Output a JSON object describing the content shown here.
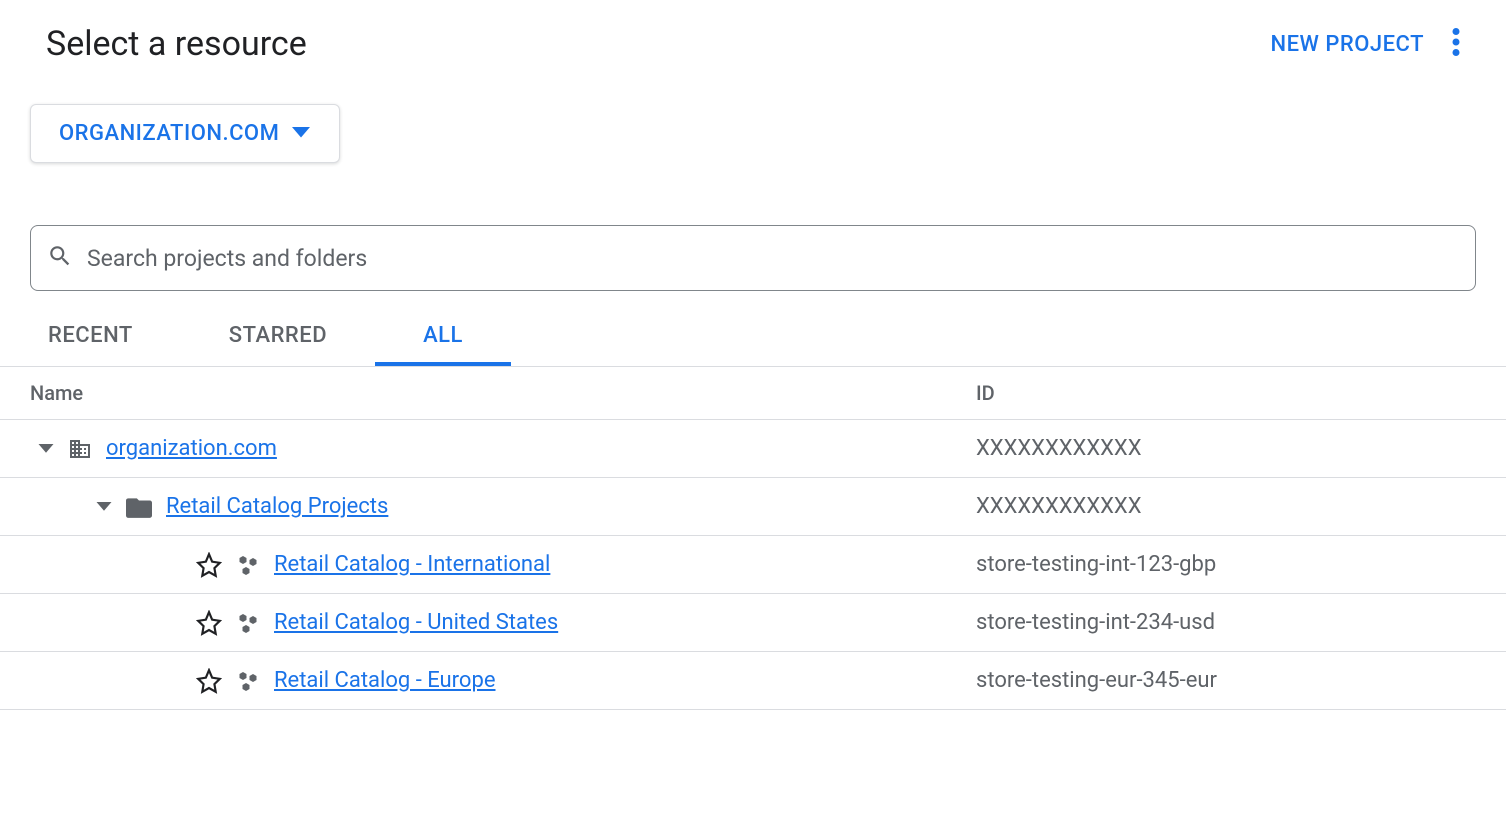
{
  "header": {
    "title": "Select a resource",
    "new_project_label": "NEW PROJECT"
  },
  "organization": {
    "label": "ORGANIZATION.COM"
  },
  "search": {
    "placeholder": "Search projects and folders"
  },
  "tabs": [
    {
      "label": "RECENT",
      "active": false
    },
    {
      "label": "STARRED",
      "active": false
    },
    {
      "label": "ALL",
      "active": true
    }
  ],
  "columns": {
    "name": "Name",
    "id": "ID"
  },
  "tree": {
    "org": {
      "name": "organization.com",
      "id": "XXXXXXXXXXXX"
    },
    "folder": {
      "name": "Retail Catalog Projects",
      "id": "XXXXXXXXXXXX"
    },
    "projects": [
      {
        "name": "Retail Catalog - International",
        "id": "store-testing-int-123-gbp"
      },
      {
        "name": "Retail Catalog - United States",
        "id": "store-testing-int-234-usd"
      },
      {
        "name": "Retail Catalog - Europe",
        "id": "store-testing-eur-345-eur"
      }
    ]
  }
}
